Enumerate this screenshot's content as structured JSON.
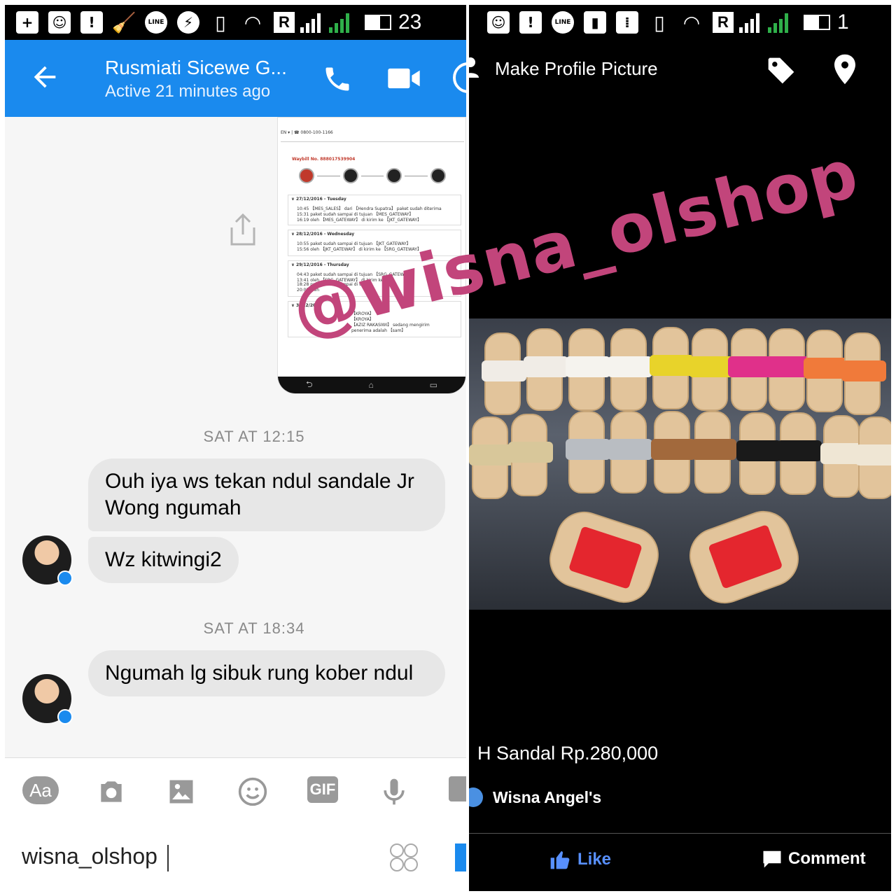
{
  "left_panel": {
    "status_bar": {
      "time": "23"
    },
    "header": {
      "contact_name": "Rusmiati Sicewe G...",
      "active_status": "Active 21 minutes ago"
    },
    "shared_screenshot": {
      "phone": "EN ▾ | ☎ 0800-100-1166",
      "waybill": "Waybill No. 888017539904",
      "entries": [
        {
          "date": "∨ 27/12/2016 - Tuesday",
          "lines": [
            "10:45   【MES_SALES】 dari 【Hendra Supatra】 paket sudah diterima",
            "15:31   paket sudah sampai di tujuan 【MES_GATEWAY】",
            "16:19   oleh 【MES_GATEWAY】 di kirim ke 【JKT_GATEWAY】"
          ]
        },
        {
          "date": "∨ 28/12/2016 - Wednesday",
          "lines": [
            "10:55   paket sudah sampai di tujuan 【JKT_GATEWAY】",
            "15:56   oleh 【JKT_GATEWAY】 di kirim ke 【SRG_GATEWAY】"
          ]
        },
        {
          "date": "∨ 29/12/2016 - Thursday",
          "lines": [
            "04:43   paket sudah sampai di tujuan 【SRG_GATEWAY】",
            "13:41   oleh 【SRG_GATEWAY】 di kirim ke",
            "18:28   paket sudah sampai di tujuan",
            "20:05   oleh"
          ]
        },
        {
          "date": "∨ 3_/12/2016",
          "lines": [
            "【KROYA】",
            "【KROYA】",
            "【AZIZ RAKASIWI】 sedang mengirim",
            "penerima adalah 【sam】"
          ]
        }
      ]
    },
    "messages": [
      {
        "timestamp": "SAT AT 12:15",
        "bubbles": [
          "Ouh iya ws tekan ndul sandale Jr Wong ngumah",
          "Wz kitwingi2"
        ]
      },
      {
        "timestamp": "SAT AT 18:34",
        "bubbles": [
          "Ngumah lg sibuk rung kober ndul"
        ]
      }
    ],
    "composer": {
      "aa_label": "Aa",
      "gif_label": "GIF",
      "input_value": "wisna_olshop"
    }
  },
  "right_panel": {
    "status_bar": {
      "time": "1"
    },
    "title": "Make Profile Picture",
    "caption": "H Sandal Rp.280,000",
    "liker": "Wisna Angel's",
    "like_label": "Like",
    "comment_label": "Comment"
  },
  "watermark": "@wisna_olshop",
  "colors": {
    "messenger_blue": "#1a8aee",
    "bubble_gray": "#e7e7e7",
    "watermark_pink": "#c2457b",
    "fb_like_blue": "#5890ff"
  }
}
